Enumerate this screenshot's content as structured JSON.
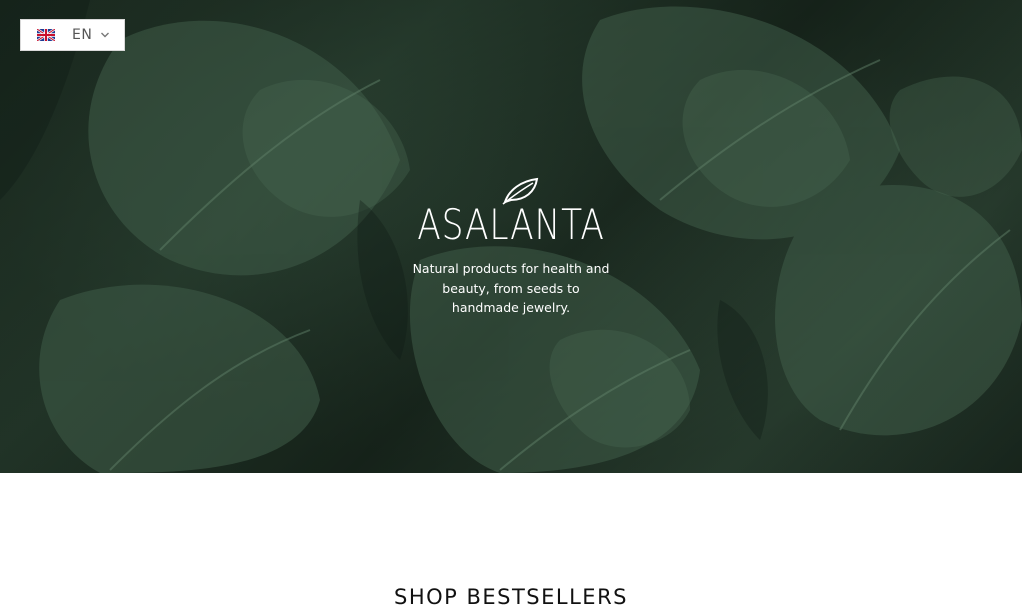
{
  "language_switcher": {
    "code": "EN",
    "flag_icon": "uk-flag-icon",
    "dropdown_icon": "chevron-down-icon"
  },
  "hero": {
    "logo_icon": "leaf-icon",
    "brand_name": "ASALANTA",
    "tagline": "Natural products for health and beauty, from seeds to handmade jewelry.",
    "background": "monstera-leaves-photo"
  },
  "bestsellers": {
    "title": "SHOP BESTSELLERS"
  },
  "colors": {
    "text_on_hero": "#ffffff",
    "foliage_dark": "#1b2a20",
    "foliage_mid": "#2d4535",
    "heading": "#111111"
  }
}
